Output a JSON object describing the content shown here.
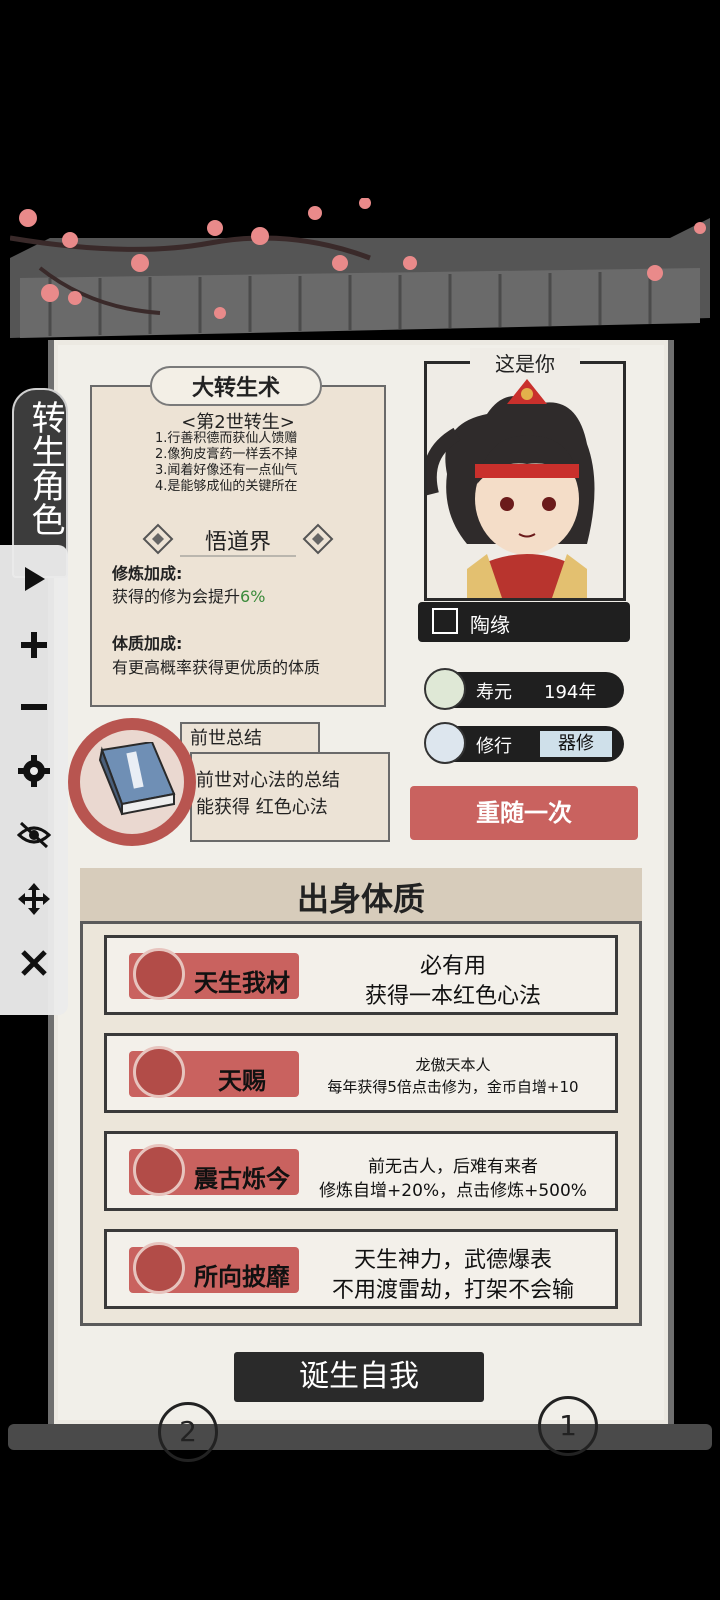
{
  "rebirth_tag": "转生角色",
  "technique": {
    "title": "大转生术",
    "subtitle": "<第2世转生>",
    "lines": [
      "1.行善积德而获仙人馈赠",
      "2.像狗皮膏药一样丢不掉",
      "3.闻着好像还有一点仙气",
      "4.是能够成仙的关键所在"
    ],
    "realm": "悟道界",
    "cultivation_label": "修炼加成:",
    "cultivation_text": "获得的修为会提升",
    "cultivation_value": "6%",
    "physique_label": "体质加成:",
    "physique_text": "有更高概率获得更优质的体质"
  },
  "character": {
    "you_label": "这是你",
    "name": "陶缘",
    "lifespan_label": "寿元",
    "lifespan_value": "194年",
    "practice_label": "修行",
    "practice_value": "器修"
  },
  "summary": {
    "tab": "前世总结",
    "line1": "前世对心法的总结",
    "line2": "能获得 红色心法"
  },
  "reroll_label": "重随一次",
  "origin": {
    "title": "出身体质",
    "traits": [
      {
        "name": "天生我材",
        "line1": "必有用",
        "line2": "获得一本红色心法"
      },
      {
        "name": "天赐",
        "line1": "龙傲天本人",
        "line2": "每年获得5倍点击修为，金币自增+10"
      },
      {
        "name": "震古烁今",
        "line1": "前无古人，后难有来者",
        "line2": "修炼自增+20%，点击修炼+500%"
      },
      {
        "name": "所向披靡",
        "line1": "天生神力，武德爆表",
        "line2": "不用渡雷劫，打架不会输"
      }
    ]
  },
  "birth_label": "诞生自我",
  "pages": {
    "left": "2",
    "right": "1"
  },
  "toolbar": [
    "play-icon",
    "plus-icon",
    "minus-icon",
    "gear-icon",
    "eye-off-icon",
    "move-icon",
    "close-icon"
  ],
  "colors": {
    "accent_red": "#c9625f",
    "ink": "#1f1f1f",
    "green": "#3a8a3a",
    "paper": "#f1efe9"
  }
}
